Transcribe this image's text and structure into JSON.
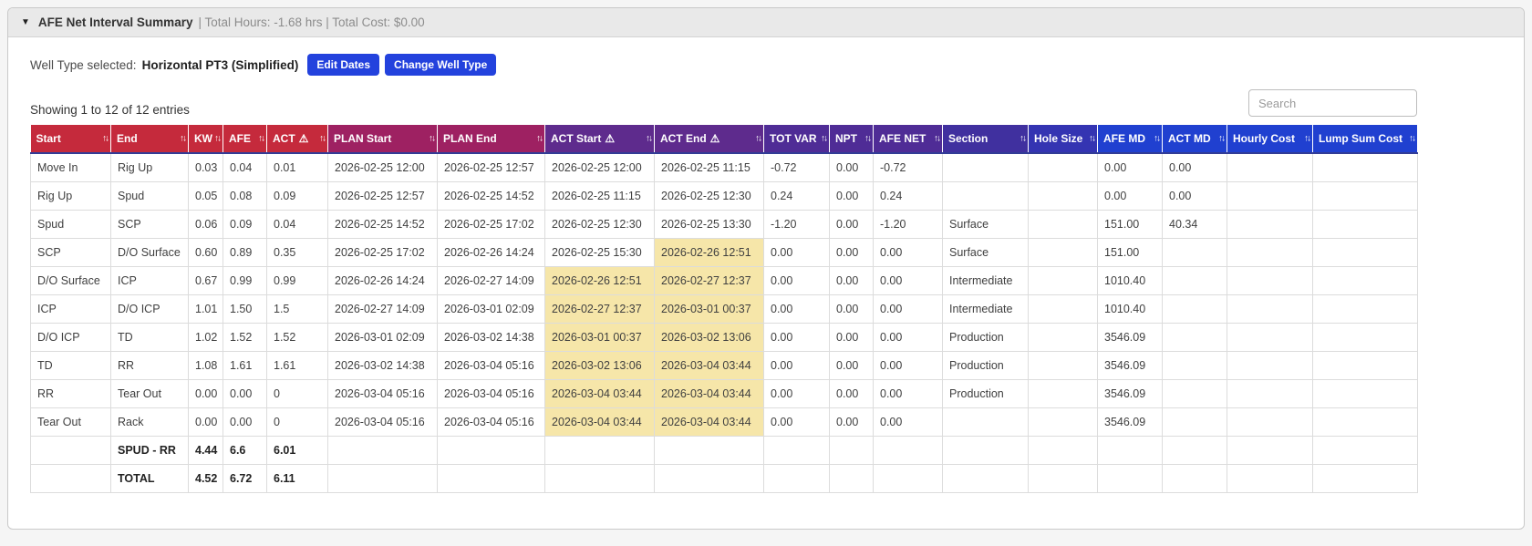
{
  "header": {
    "collapse_icon": "▼",
    "title": "AFE Net Interval Summary",
    "subtitle": "| Total Hours: -1.68 hrs | Total Cost: $0.00"
  },
  "well_type": {
    "label": "Well Type selected:",
    "value": "Horizontal PT3 (Simplified)"
  },
  "buttons": {
    "edit_dates": "Edit Dates",
    "change_well_type": "Change Well Type"
  },
  "entries_info": "Showing 1 to 12 of 12 entries",
  "search": {
    "placeholder": "Search",
    "value": ""
  },
  "icons": {
    "sort": "↑↓",
    "warning": "⚠"
  },
  "colors": {
    "highlight": "#f6e6a9",
    "button_blue": "#2342dd",
    "header_red": "#c52a3c",
    "header_maroon": "#9e2162",
    "header_purple": "#5e2b8d",
    "header_deep_purple": "#4f2c96",
    "header_indigo": "#40309f",
    "header_blue_indigo": "#3434b2",
    "header_blue": "#2040d0"
  },
  "table": {
    "columns": [
      {
        "label": "Start",
        "color": "#c52a3c",
        "warning": false
      },
      {
        "label": "End",
        "color": "#c52a3c",
        "warning": false
      },
      {
        "label": "KW",
        "color": "#c52a3c",
        "warning": false
      },
      {
        "label": "AFE",
        "color": "#c52a3c",
        "warning": false
      },
      {
        "label": "ACT",
        "color": "#c52a3c",
        "warning": true
      },
      {
        "label": "PLAN Start",
        "color": "#9e2162",
        "warning": false
      },
      {
        "label": "PLAN End",
        "color": "#9e2162",
        "warning": false
      },
      {
        "label": "ACT Start",
        "color": "#5e2b8d",
        "warning": true
      },
      {
        "label": "ACT End",
        "color": "#5e2b8d",
        "warning": true
      },
      {
        "label": "TOT VAR",
        "color": "#4f2c96",
        "warning": false
      },
      {
        "label": "NPT",
        "color": "#4f2c96",
        "warning": false
      },
      {
        "label": "AFE NET",
        "color": "#4f2c96",
        "warning": false
      },
      {
        "label": "Section",
        "color": "#40309f",
        "warning": false
      },
      {
        "label": "Hole Size",
        "color": "#3434b2",
        "warning": false
      },
      {
        "label": "AFE MD",
        "color": "#2040d0",
        "warning": false
      },
      {
        "label": "ACT MD",
        "color": "#2040d0",
        "warning": false
      },
      {
        "label": "Hourly Cost",
        "color": "#2040d0",
        "warning": false
      },
      {
        "label": "Lump Sum Cost",
        "color": "#2040d0",
        "warning": false
      }
    ],
    "rows": [
      {
        "cells": [
          "Move In",
          "Rig Up",
          "0.03",
          "0.04",
          "0.01",
          "2026-02-25 12:00",
          "2026-02-25 12:57",
          "2026-02-25 12:00",
          "2026-02-25 11:15",
          "-0.72",
          "0.00",
          "-0.72",
          "",
          "",
          "0.00",
          "0.00",
          "",
          ""
        ],
        "highlights": []
      },
      {
        "cells": [
          "Rig Up",
          "Spud",
          "0.05",
          "0.08",
          "0.09",
          "2026-02-25 12:57",
          "2026-02-25 14:52",
          "2026-02-25 11:15",
          "2026-02-25 12:30",
          "0.24",
          "0.00",
          "0.24",
          "",
          "",
          "0.00",
          "0.00",
          "",
          ""
        ],
        "highlights": []
      },
      {
        "cells": [
          "Spud",
          "SCP",
          "0.06",
          "0.09",
          "0.04",
          "2026-02-25 14:52",
          "2026-02-25 17:02",
          "2026-02-25 12:30",
          "2026-02-25 13:30",
          "-1.20",
          "0.00",
          "-1.20",
          "Surface",
          "",
          "151.00",
          "40.34",
          "",
          ""
        ],
        "highlights": []
      },
      {
        "cells": [
          "SCP",
          "D/O Surface",
          "0.60",
          "0.89",
          "0.35",
          "2026-02-25 17:02",
          "2026-02-26 14:24",
          "2026-02-25 15:30",
          "2026-02-26 12:51",
          "0.00",
          "0.00",
          "0.00",
          "Surface",
          "",
          "151.00",
          "",
          "",
          ""
        ],
        "highlights": [
          8
        ]
      },
      {
        "cells": [
          "D/O Surface",
          "ICP",
          "0.67",
          "0.99",
          "0.99",
          "2026-02-26 14:24",
          "2026-02-27 14:09",
          "2026-02-26 12:51",
          "2026-02-27 12:37",
          "0.00",
          "0.00",
          "0.00",
          "Intermediate",
          "",
          "1010.40",
          "",
          "",
          ""
        ],
        "highlights": [
          7,
          8
        ]
      },
      {
        "cells": [
          "ICP",
          "D/O ICP",
          "1.01",
          "1.50",
          "1.5",
          "2026-02-27 14:09",
          "2026-03-01 02:09",
          "2026-02-27 12:37",
          "2026-03-01 00:37",
          "0.00",
          "0.00",
          "0.00",
          "Intermediate",
          "",
          "1010.40",
          "",
          "",
          ""
        ],
        "highlights": [
          7,
          8
        ]
      },
      {
        "cells": [
          "D/O ICP",
          "TD",
          "1.02",
          "1.52",
          "1.52",
          "2026-03-01 02:09",
          "2026-03-02 14:38",
          "2026-03-01 00:37",
          "2026-03-02 13:06",
          "0.00",
          "0.00",
          "0.00",
          "Production",
          "",
          "3546.09",
          "",
          "",
          ""
        ],
        "highlights": [
          7,
          8
        ]
      },
      {
        "cells": [
          "TD",
          "RR",
          "1.08",
          "1.61",
          "1.61",
          "2026-03-02 14:38",
          "2026-03-04 05:16",
          "2026-03-02 13:06",
          "2026-03-04 03:44",
          "0.00",
          "0.00",
          "0.00",
          "Production",
          "",
          "3546.09",
          "",
          "",
          ""
        ],
        "highlights": [
          7,
          8
        ]
      },
      {
        "cells": [
          "RR",
          "Tear Out",
          "0.00",
          "0.00",
          "0",
          "2026-03-04 05:16",
          "2026-03-04 05:16",
          "2026-03-04 03:44",
          "2026-03-04 03:44",
          "0.00",
          "0.00",
          "0.00",
          "Production",
          "",
          "3546.09",
          "",
          "",
          ""
        ],
        "highlights": [
          7,
          8
        ]
      },
      {
        "cells": [
          "Tear Out",
          "Rack",
          "0.00",
          "0.00",
          "0",
          "2026-03-04 05:16",
          "2026-03-04 05:16",
          "2026-03-04 03:44",
          "2026-03-04 03:44",
          "0.00",
          "0.00",
          "0.00",
          "",
          "",
          "3546.09",
          "",
          "",
          ""
        ],
        "highlights": [
          7,
          8
        ]
      },
      {
        "cells": [
          "",
          "SPUD - RR",
          "4.44",
          "6.6",
          "6.01",
          "",
          "",
          "",
          "",
          "",
          "",
          "",
          "",
          "",
          "",
          "",
          "",
          ""
        ],
        "highlights": [],
        "bold": true
      },
      {
        "cells": [
          "",
          "TOTAL",
          "4.52",
          "6.72",
          "6.11",
          "",
          "",
          "",
          "",
          "",
          "",
          "",
          "",
          "",
          "",
          "",
          "",
          ""
        ],
        "highlights": [],
        "bold": true
      }
    ]
  }
}
